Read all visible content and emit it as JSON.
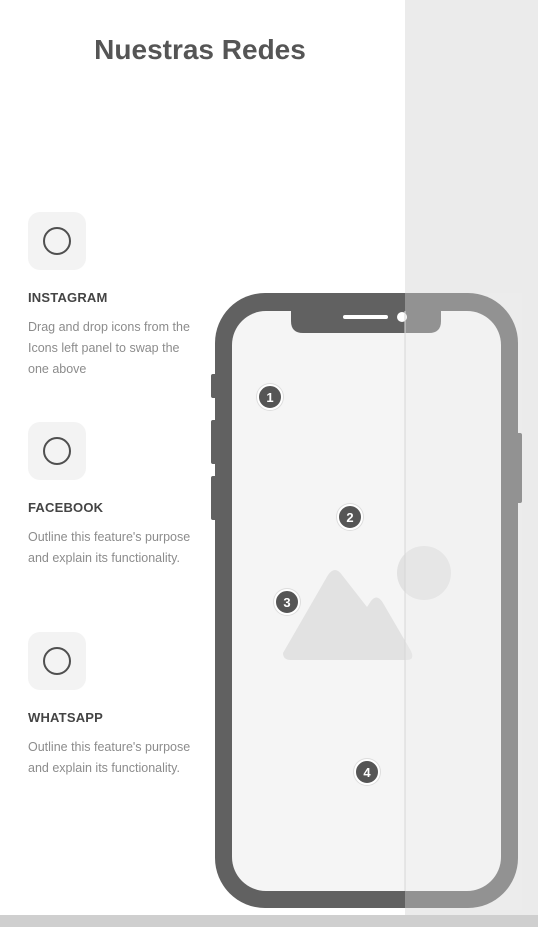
{
  "page": {
    "title": "Nuestras Redes"
  },
  "features": [
    {
      "icon": "circle-outline-icon",
      "name": "INSTAGRAM",
      "description": "Drag and drop icons from the Icons left panel to swap the one above"
    },
    {
      "icon": "circle-outline-icon",
      "name": "FACEBOOK",
      "description": "Outline this feature's purpose and explain its functionality."
    },
    {
      "icon": "circle-outline-icon",
      "name": "WHATSAPP",
      "description": "Outline this feature's purpose and explain its functionality."
    }
  ],
  "phone": {
    "icon": "image-placeholder-icon",
    "markers": [
      "1",
      "2",
      "3",
      "4"
    ]
  },
  "colors": {
    "phone_frame": "#616161",
    "screen": "#f5f5f5",
    "side_panel": "#ebebeb",
    "title": "#555555"
  }
}
